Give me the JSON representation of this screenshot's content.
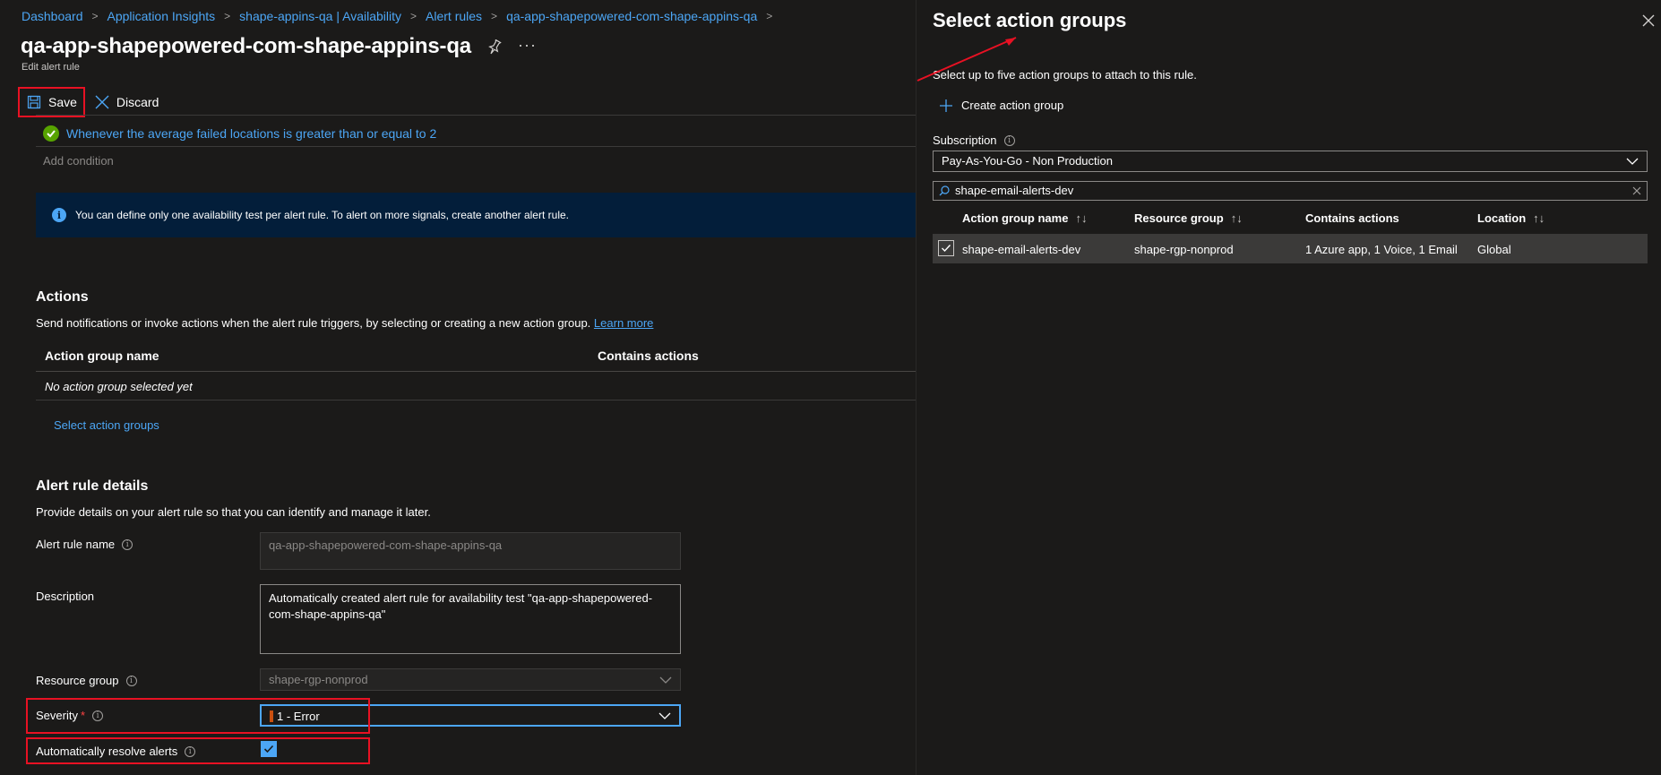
{
  "breadcrumb": [
    "Dashboard",
    "Application Insights",
    "shape-appins-qa | Availability",
    "Alert rules",
    "qa-app-shapepowered-com-shape-appins-qa"
  ],
  "page": {
    "title": "qa-app-shapepowered-com-shape-appins-qa",
    "subtitle": "Edit alert rule",
    "more": "···"
  },
  "toolbar": {
    "save_label": "Save",
    "discard_label": "Discard"
  },
  "condition": {
    "text": "Whenever the average failed locations is greater than or equal to 2",
    "add_label": "Add condition"
  },
  "info_banner": "You can define only one availability test per alert rule. To alert on more signals, create another alert rule.",
  "actions": {
    "heading": "Actions",
    "description": "Send notifications or invoke actions when the alert rule triggers, by selecting or creating a new action group.",
    "learn_more": "Learn more",
    "col_name": "Action group name",
    "col_actions": "Contains actions",
    "empty": "No action group selected yet",
    "select_label": "Select action groups"
  },
  "details": {
    "heading": "Alert rule details",
    "description": "Provide details on your alert rule so that you can identify and manage it later.",
    "name_label": "Alert rule name",
    "name_value": "qa-app-shapepowered-com-shape-appins-qa",
    "desc_label": "Description",
    "desc_value": "Automatically created alert rule for availability test \"qa-app-shapepowered-com-shape-appins-qa\"",
    "rg_label": "Resource group",
    "rg_value": "shape-rgp-nonprod",
    "severity_label": "Severity",
    "severity_required": "*",
    "severity_value": "1 - Error",
    "auto_resolve_label": "Automatically resolve alerts",
    "auto_resolve_checked": true
  },
  "panel": {
    "title": "Select action groups",
    "description": "Select up to five action groups to attach to this rule.",
    "create_label": "Create action group",
    "subscription_label": "Subscription",
    "subscription_value": "Pay-As-You-Go - Non Production",
    "search_value": "shape-email-alerts-dev",
    "columns": [
      "Action group name",
      "Resource group",
      "Contains actions",
      "Location"
    ],
    "rows": [
      {
        "name": "shape-email-alerts-dev",
        "resource_group": "shape-rgp-nonprod",
        "actions": "1 Azure app, 1 Voice, 1 Email",
        "location": "Global",
        "checked": true
      }
    ]
  },
  "colors": {
    "accent": "#4ca6f5",
    "highlight": "#e81123",
    "success": "#57a300",
    "severity": "#ca5010"
  }
}
